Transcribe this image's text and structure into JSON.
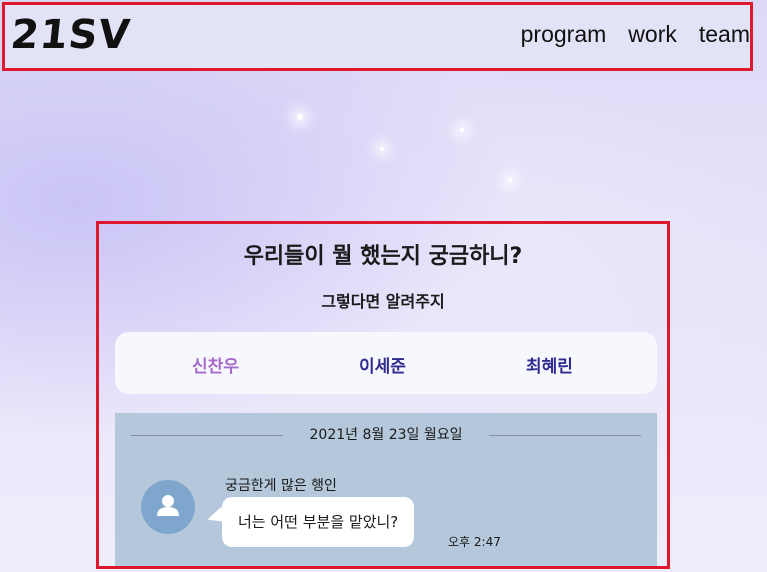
{
  "header": {
    "logo": "21SV",
    "nav": [
      "program",
      "work",
      "team"
    ]
  },
  "main": {
    "title": "우리들이 뭘 했는지 궁금하니?",
    "subtitle": "그렇다면 알려주지",
    "tabs": [
      {
        "label": "신찬우",
        "color": "#a56acb"
      },
      {
        "label": "이세준",
        "color": "#2f2b8f"
      },
      {
        "label": "최혜린",
        "color": "#2f2b8f"
      }
    ],
    "chat": {
      "date": "2021년 8월 23일 월요일",
      "sender": "궁금한게 많은 행인",
      "message": "너는 어떤 부분을 맡았니?",
      "time": "오후 2:47"
    }
  },
  "colors": {
    "highlight_border": "#e0182d",
    "chat_background": "#b4c7db",
    "avatar": "#7fa6cc"
  },
  "icons": {
    "avatar": "user-silhouette-icon"
  }
}
